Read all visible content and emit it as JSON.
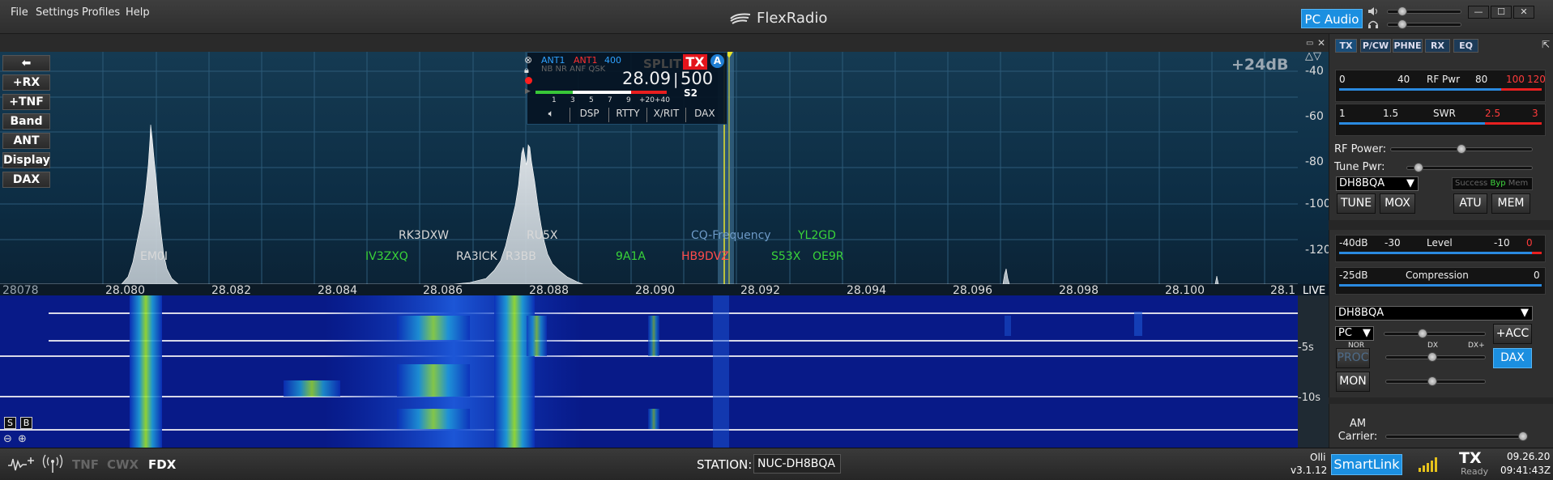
{
  "menu": [
    "File",
    "Settings",
    "Profiles",
    "Help"
  ],
  "app_title": "FlexRadio",
  "pc_audio_label": "PC Audio",
  "window_buttons": [
    "—",
    "☐",
    "✕"
  ],
  "panadapter": {
    "gain_label": "+24dB",
    "left_buttons": [
      "+RX",
      "+TNF",
      "Band",
      "ANT",
      "Display",
      "DAX"
    ],
    "db_scale": [
      "-40",
      "-60",
      "-80",
      "-100",
      "-120"
    ],
    "freq_ticks": [
      "28078",
      "28.080",
      "28.082",
      "28.084",
      "28.086",
      "28.088",
      "28.090",
      "28.092",
      "28.094",
      "28.096",
      "28.098",
      "28.100",
      "28.1"
    ],
    "live_label": "LIVE",
    "spots": [
      {
        "call": "EM0I",
        "color": "#d8d8d8"
      },
      {
        "call": "RK3DXW",
        "color": "#d8d8d8"
      },
      {
        "call": "IV3ZXQ",
        "color": "#39d339"
      },
      {
        "call": "RA3ICK",
        "color": "#d8d8d8"
      },
      {
        "call": "R3BB",
        "color": "#d8d8d8"
      },
      {
        "call": "RU5X",
        "color": "#d8d8d8"
      },
      {
        "call": "9A1A",
        "color": "#39d339"
      },
      {
        "call": "CQ-Frequency",
        "color": "#6d9ac7"
      },
      {
        "call": "HB9DVZ",
        "color": "#ff4b4b"
      },
      {
        "call": "YL2GD",
        "color": "#39d339"
      },
      {
        "call": "S53X",
        "color": "#39d339"
      },
      {
        "call": "OE9R",
        "color": "#39d339"
      }
    ],
    "sb_buttons": [
      "S",
      "B"
    ]
  },
  "vfo": {
    "rx_ant": "ANT1",
    "tx_ant": "ANT1",
    "bandwidth": "400",
    "filters": "NB NR ANF QSK",
    "split": "SPLIT",
    "tx_badge": "TX",
    "slice": "A",
    "freq_main": "28.09",
    "freq_sub": "500",
    "smeter_ticks": [
      "1",
      "3",
      "5",
      "7",
      "9",
      "+20",
      "+40"
    ],
    "s_reading": "S2",
    "buttons": [
      "DSP",
      "RTTY",
      "X/RIT",
      "DAX"
    ]
  },
  "waterfall": {
    "labels": [
      "-5s",
      "-10s"
    ]
  },
  "right_panel": {
    "tabs": [
      "TX",
      "P/CW",
      "PHNE",
      "RX",
      "EQ"
    ],
    "rfpwr_meter": {
      "ticks": [
        "0",
        "40",
        "80",
        "100",
        "120"
      ],
      "title": "RF Pwr"
    },
    "swr_meter": {
      "ticks": [
        "1",
        "1.5",
        "2.5",
        "3"
      ],
      "title": "SWR"
    },
    "rf_power_label": "RF Power:",
    "rf_power_level": 0.5,
    "tune_power_label": "Tune Pwr:",
    "tune_power_level": 0.06,
    "tx_profile": "DH8BQA",
    "atu_status": [
      "Success",
      "Byp",
      "Mem"
    ],
    "tx_buttons": [
      "TUNE",
      "MOX",
      "ATU",
      "MEM"
    ],
    "level_meter": {
      "ticks": [
        "-40dB",
        "-30",
        "-10",
        "0"
      ],
      "title": "Level"
    },
    "compression_meter": {
      "ticks": [
        "-25dB",
        "0"
      ],
      "title": "Compression"
    },
    "mic_profile": "DH8BQA",
    "mic_source": "PC",
    "acc_button": "+ACC",
    "proc_levels": [
      "NOR",
      "DX",
      "DX+"
    ],
    "proc_button": "PROC",
    "dax_button": "DAX",
    "mon_button": "MON",
    "am_carrier_label": "AM Carrier:"
  },
  "status": {
    "mode_labels": [
      "TNF",
      "CWX",
      "FDX"
    ],
    "station_label": "STATION:",
    "station_name": "NUC-DH8BQA",
    "user": "Olli",
    "version": "v3.1.12",
    "smartlink_label": "SmartLink",
    "tx_status": "TX",
    "tx_state": "Ready",
    "date": "09.26.20",
    "time": "09:41:43Z"
  }
}
